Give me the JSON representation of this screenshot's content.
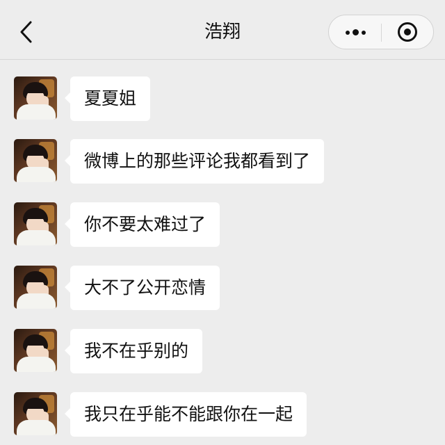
{
  "header": {
    "title": "浩翔",
    "back_icon": "chevron-left-icon",
    "more_icon": "more-dots-icon",
    "close_icon": "target-close-icon"
  },
  "messages": [
    {
      "sender": "浩翔",
      "text": "夏夏姐"
    },
    {
      "sender": "浩翔",
      "text": "微博上的那些评论我都看到了"
    },
    {
      "sender": "浩翔",
      "text": "你不要太难过了"
    },
    {
      "sender": "浩翔",
      "text": "大不了公开恋情"
    },
    {
      "sender": "浩翔",
      "text": "我不在乎别的"
    },
    {
      "sender": "浩翔",
      "text": "我只在乎能不能跟你在一起"
    }
  ],
  "colors": {
    "background": "#ededed",
    "bubble": "#ffffff",
    "text": "#111111"
  }
}
